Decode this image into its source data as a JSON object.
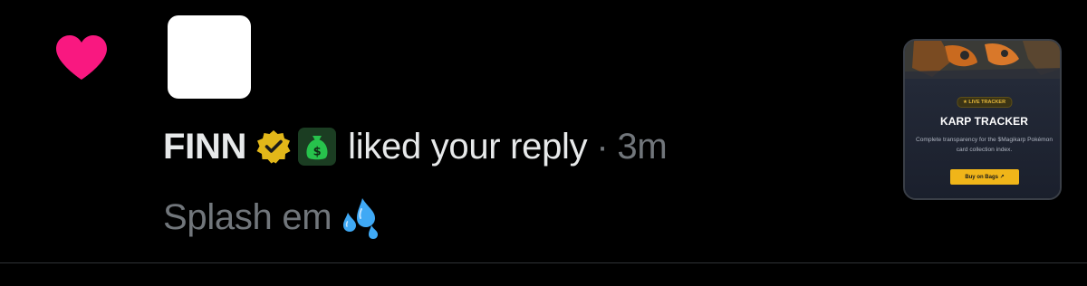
{
  "notification": {
    "user": {
      "name": "FINN",
      "verified_badge": "gold-verified-icon",
      "profile_emoji": "money-bag-icon"
    },
    "action": "liked your reply",
    "separator": "·",
    "time": "3m",
    "reply_text": "Splash em",
    "reply_emoji": "sweat-droplets-icon",
    "type_icon": "heart-icon"
  },
  "preview_card": {
    "badge": "★ LIVE TRACKER",
    "title": "KARP TRACKER",
    "description": "Complete transparency for the $Magikarp Pokémon card collection index.",
    "button_label": "Buy on Bags ↗"
  },
  "colors": {
    "background": "#000000",
    "heart": "#f91880",
    "text_primary": "#e7e9ea",
    "text_secondary": "#71767b",
    "card_button": "#f0b519",
    "divider": "#2f3336"
  }
}
